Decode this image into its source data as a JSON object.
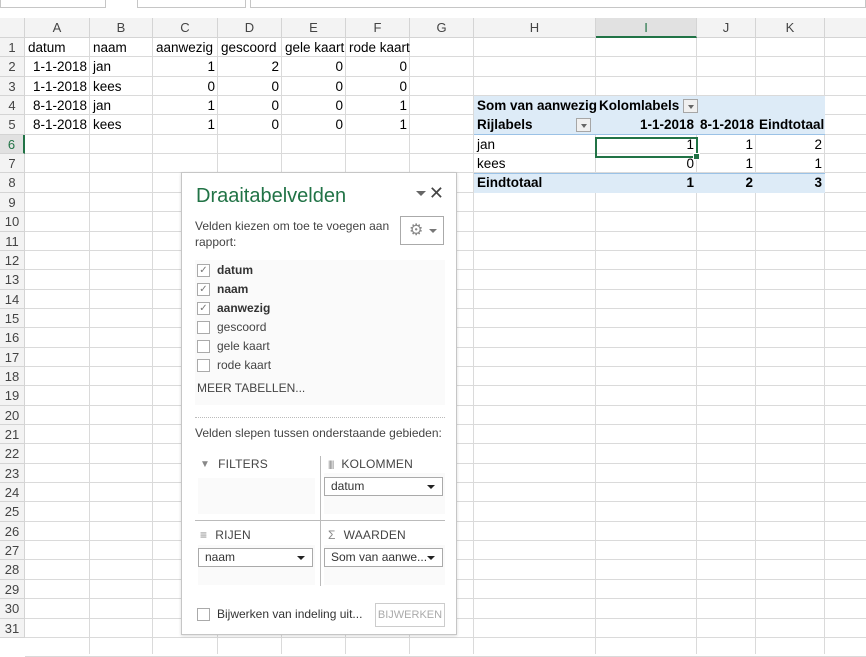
{
  "columns": [
    "A",
    "B",
    "C",
    "D",
    "E",
    "F",
    "G",
    "H",
    "I",
    "J",
    "K"
  ],
  "selected_column": "I",
  "selected_row": 6,
  "row_count": 31,
  "sheet": [
    [
      "datum",
      "naam",
      "aanwezig",
      "gescoord",
      "gele kaart",
      "rode kaart"
    ],
    [
      "1-1-2018",
      "jan",
      "1",
      "2",
      "0",
      "0"
    ],
    [
      "1-1-2018",
      "kees",
      "0",
      "0",
      "0",
      "0"
    ],
    [
      "8-1-2018",
      "jan",
      "1",
      "0",
      "0",
      "1"
    ],
    [
      "8-1-2018",
      "kees",
      "1",
      "0",
      "0",
      "1"
    ]
  ],
  "pivot": {
    "value_label": "Som van aanwezig",
    "column_labels": "Kolomlabels",
    "row_labels": "Rijlabels",
    "col_headers": [
      "1-1-2018",
      "8-1-2018",
      "Eindtotaal"
    ],
    "rows": [
      {
        "label": "jan",
        "values": [
          "1",
          "1",
          "2"
        ]
      },
      {
        "label": "kees",
        "values": [
          "0",
          "1",
          "1"
        ]
      }
    ],
    "total": {
      "label": "Eindtotaal",
      "values": [
        "1",
        "2",
        "3"
      ]
    }
  },
  "panel": {
    "title": "Draaitabelvelden",
    "close": "✕",
    "description": "Velden kiezen om toe te voegen aan rapport:",
    "gear": "⚙",
    "fields": [
      {
        "label": "datum",
        "checked": true
      },
      {
        "label": "naam",
        "checked": true
      },
      {
        "label": "aanwezig",
        "checked": true
      },
      {
        "label": "gescoord",
        "checked": false
      },
      {
        "label": "gele kaart",
        "checked": false
      },
      {
        "label": "rode kaart",
        "checked": false
      }
    ],
    "more_tables": "MEER TABELLEN...",
    "drag_label": "Velden slepen tussen onderstaande gebieden:",
    "filters": {
      "label": "FILTERS",
      "icon": "▼"
    },
    "columns": {
      "label": "KOLOMMEN",
      "icon": "||||",
      "value": "datum"
    },
    "rows": {
      "label": "RIJEN",
      "icon": "≡",
      "value": "naam"
    },
    "values": {
      "label": "WAARDEN",
      "icon": "Σ",
      "value": "Som van aanwe..."
    },
    "defer_label": "Bijwerken van indeling uit...",
    "update_button": "BIJWERKEN"
  }
}
